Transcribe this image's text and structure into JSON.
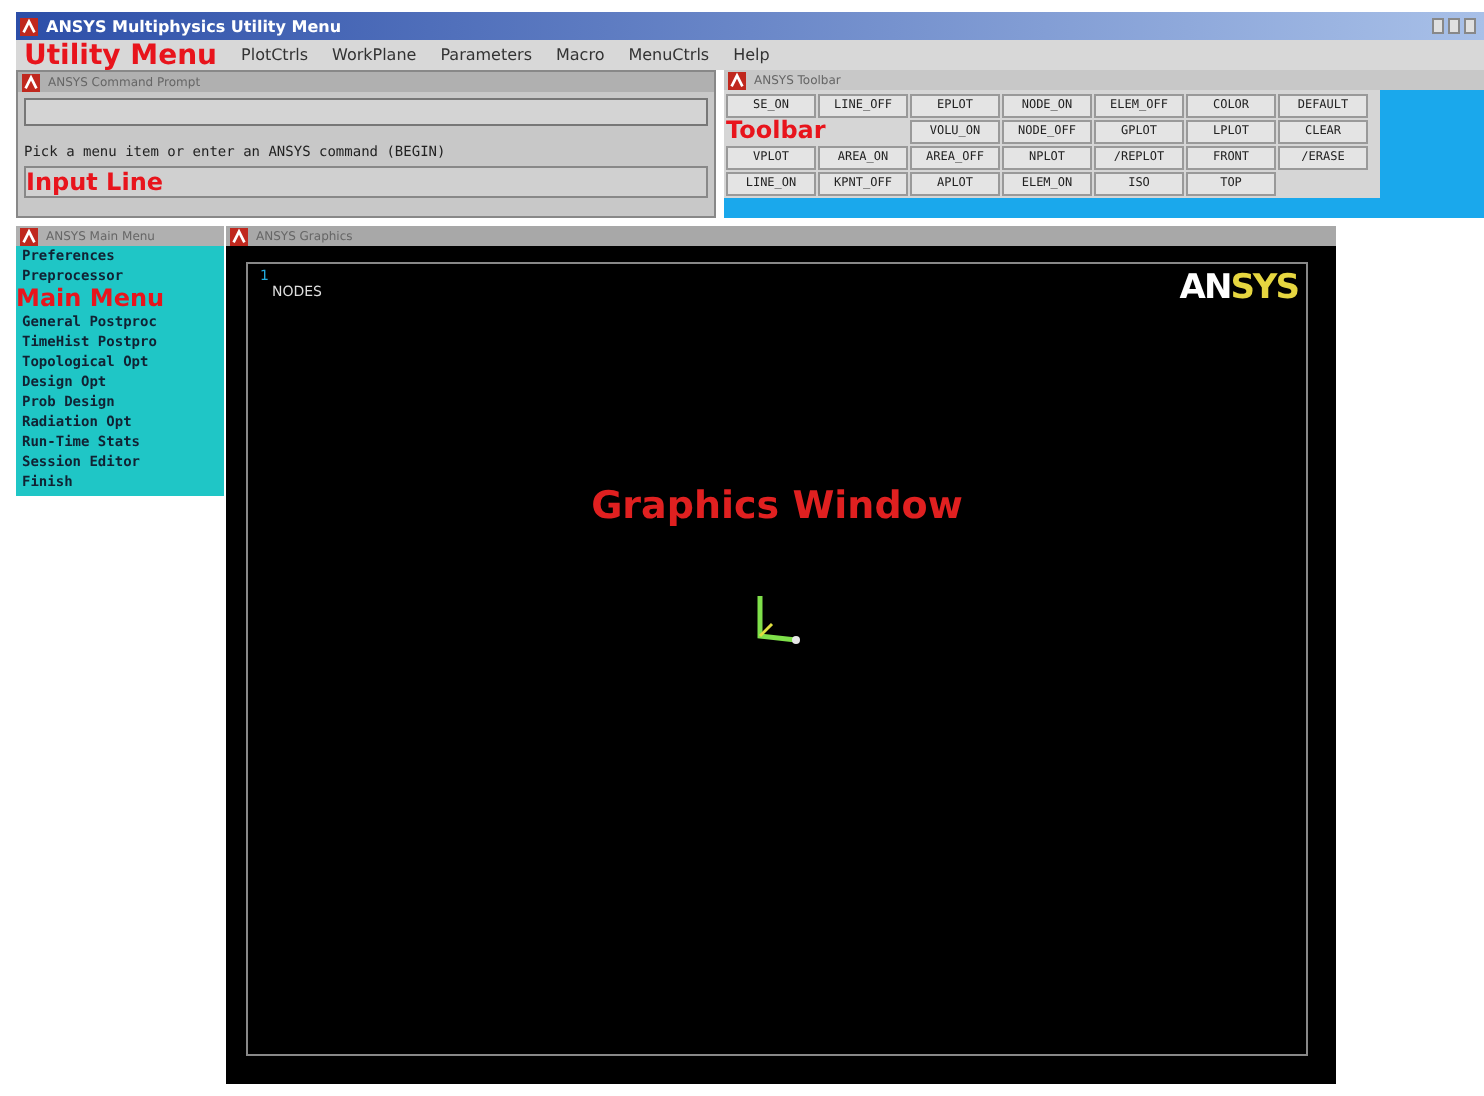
{
  "window": {
    "title": "ANSYS Multiphysics Utility Menu"
  },
  "utility_menu": {
    "label": "Utility Menu",
    "items": [
      "PlotCtrls",
      "WorkPlane",
      "Parameters",
      "Macro",
      "MenuCtrls",
      "Help"
    ]
  },
  "input_panel": {
    "title": "ANSYS Command Prompt",
    "prompt": "Pick a menu item or enter an ANSYS command (BEGIN)",
    "label": "Input Line"
  },
  "toolbar": {
    "title": "ANSYS Toolbar",
    "label": "Toolbar",
    "rows": [
      [
        "SE_ON",
        "LINE_OFF",
        "EPLOT",
        "NODE_ON",
        "ELEM_OFF",
        "COLOR",
        "DEFAULT"
      ],
      [
        "",
        "",
        "VOLU_ON",
        "NODE_OFF",
        "GPLOT",
        "LPLOT",
        "CLEAR"
      ],
      [
        "VPLOT",
        "AREA_ON",
        "AREA_OFF",
        "NPLOT",
        "/REPLOT",
        "FRONT",
        "/ERASE"
      ],
      [
        "LINE_ON",
        "KPNT_OFF",
        "APLOT",
        "ELEM_ON",
        "ISO",
        "TOP"
      ]
    ]
  },
  "main_menu": {
    "title": "ANSYS Main Menu",
    "label": "Main Menu",
    "items": [
      "Preferences",
      "Preprocessor",
      "General Postproc",
      "TimeHist Postpro",
      "Topological Opt",
      "Design Opt",
      "Prob Design",
      "Radiation Opt",
      "Run-Time Stats",
      "Session Editor",
      "Finish"
    ]
  },
  "graphics": {
    "title": "ANSYS Graphics",
    "window_number": "1",
    "plot_label": "NODES",
    "logo_left": "AN",
    "logo_right": "SYS",
    "label": "Graphics Window"
  }
}
